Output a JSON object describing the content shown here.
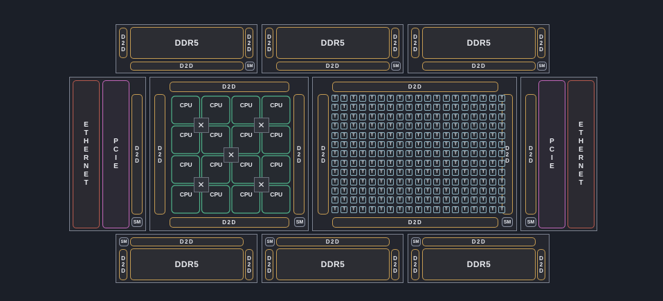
{
  "labels": {
    "ddr": "DDR5",
    "d2d": "D2D",
    "d2d_vertical": "D\n2\nD",
    "sm": "SM",
    "cpu": "CPU",
    "tile": "T",
    "ethernet": "E\nT\nH\nE\nR\nN\nE\nT",
    "pcie": "P\nC\nI\nE",
    "switch_mark": "✕"
  },
  "colors": {
    "background": "#1b1f28",
    "chiplet_border": "#7c8290",
    "d2d_border": "#c39a52",
    "ethernet_border": "#b55a4e",
    "pcie_border": "#c266b9",
    "cpu_border": "#4fb38a",
    "tile_border": "#8fb3c2"
  },
  "grid": {
    "tile_cols": 19,
    "tile_rows": 13,
    "cpu_cols": 4,
    "cpu_rows": 4
  }
}
